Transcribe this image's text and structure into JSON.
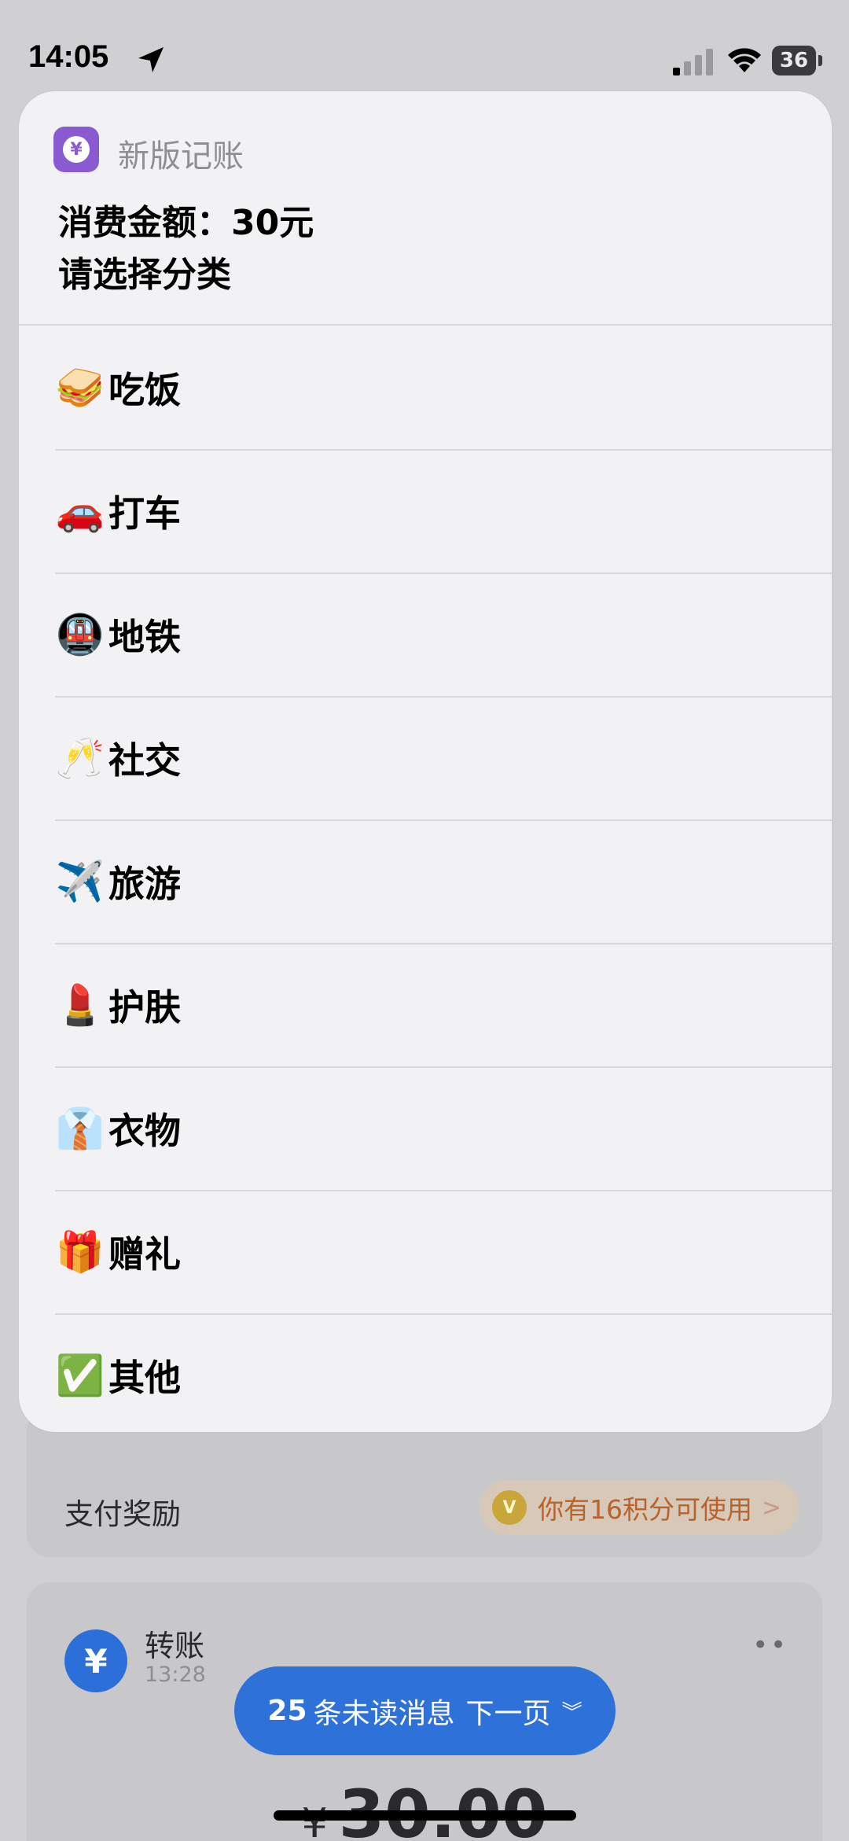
{
  "status_bar": {
    "time": "14:05",
    "battery": "36",
    "icons": [
      "location-arrow-icon",
      "cellular-signal-icon",
      "wifi-icon",
      "battery-icon"
    ]
  },
  "sheet": {
    "app_name": "新版记账",
    "app_icon": "yen-icon",
    "prompt_line1": "消费金额：",
    "amount": "30",
    "unit": "元",
    "prompt_line2": "请选择分类",
    "options": [
      {
        "emoji": "🥪",
        "icon": "sandwich-icon",
        "label": "吃饭"
      },
      {
        "emoji": "🚗",
        "icon": "car-icon",
        "label": "打车"
      },
      {
        "emoji": "🚇",
        "icon": "subway-icon",
        "label": "地铁"
      },
      {
        "emoji": "🥂",
        "icon": "champagne-icon",
        "label": "社交"
      },
      {
        "emoji": "✈️",
        "icon": "airplane-icon",
        "label": "旅游"
      },
      {
        "emoji": "💄",
        "icon": "lipstick-icon",
        "label": "护肤"
      },
      {
        "emoji": "👔",
        "icon": "shirt-tie-icon",
        "label": "衣物"
      },
      {
        "emoji": "🎁",
        "icon": "gift-icon",
        "label": "赠礼"
      },
      {
        "emoji": "✅",
        "icon": "checkmark-icon",
        "label": "其他"
      }
    ]
  },
  "background": {
    "reward_label": "支付奖励",
    "reward_text": "你有16积分可使用",
    "transfer_title": "转账",
    "transfer_time": "13:28",
    "amount_currency": "¥",
    "amount_value": "30.00",
    "unread_count": "25",
    "unread_text": "条未读消息",
    "next_page": "下一页"
  },
  "colors": {
    "sheet_bg": "#f2f2f4",
    "app_icon_purple": "#8a5ad0",
    "accent_blue": "#2e72d9",
    "reward_orange": "#b8622c"
  }
}
